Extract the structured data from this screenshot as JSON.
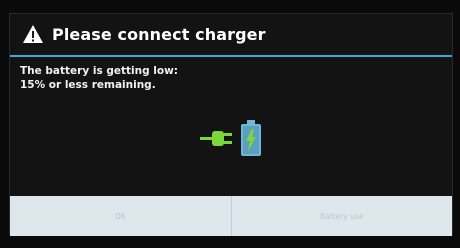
{
  "dialog": {
    "title": "Please connect charger",
    "message_line1": "The battery is getting low:",
    "message_line2": "15% or less remaining.",
    "icon": "warning-icon",
    "graphic_icons": [
      "plug-icon",
      "battery-charging-icon"
    ]
  },
  "buttons": {
    "ok_label": "OK",
    "battery_use_label": "Battery use"
  },
  "colors": {
    "accent": "#3fa7d6",
    "plug": "#7cd83a",
    "battery": "#6fb5d6"
  }
}
